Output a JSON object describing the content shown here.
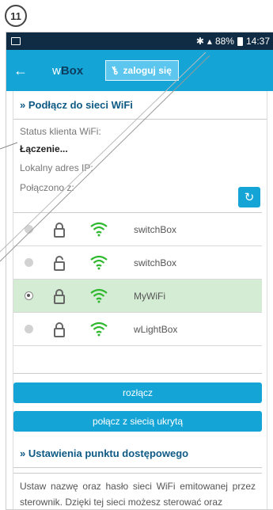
{
  "step": {
    "number": "11"
  },
  "statusbar": {
    "battery_pct": "88%",
    "time": "14:37"
  },
  "appbar": {
    "back": "←",
    "brand_prefix": "w",
    "brand_suffix": "Box",
    "login_label": "zaloguj się"
  },
  "wifi_section": {
    "title": "» Podłącz do sieci WiFi",
    "status_label": "Status klienta WiFi:",
    "status_value": "Łączenie...",
    "ip_label": "Lokalny adres IP:",
    "connected_label": "Połączono z:",
    "networks": [
      {
        "ssid": "switchBox",
        "locked": true,
        "selected": false
      },
      {
        "ssid": "switchBox",
        "locked": false,
        "selected": false
      },
      {
        "ssid": "MyWiFi",
        "locked": true,
        "selected": true
      },
      {
        "ssid": "wLightBox",
        "locked": true,
        "selected": false
      }
    ],
    "disconnect_label": "rozłącz",
    "hidden_label": "połącz z siecią ukrytą"
  },
  "ap_section": {
    "title": "» Ustawienia punktu dostępowego",
    "description": "Ustaw nazwę oraz hasło sieci WiFi emitowanej przez sterownik. Dzięki tej sieci możesz sterować oraz"
  },
  "colors": {
    "accent": "#14a4d6",
    "statusbar": "#102c44",
    "selected_row": "#d4ebd4",
    "wifi_green": "#2db82d"
  }
}
